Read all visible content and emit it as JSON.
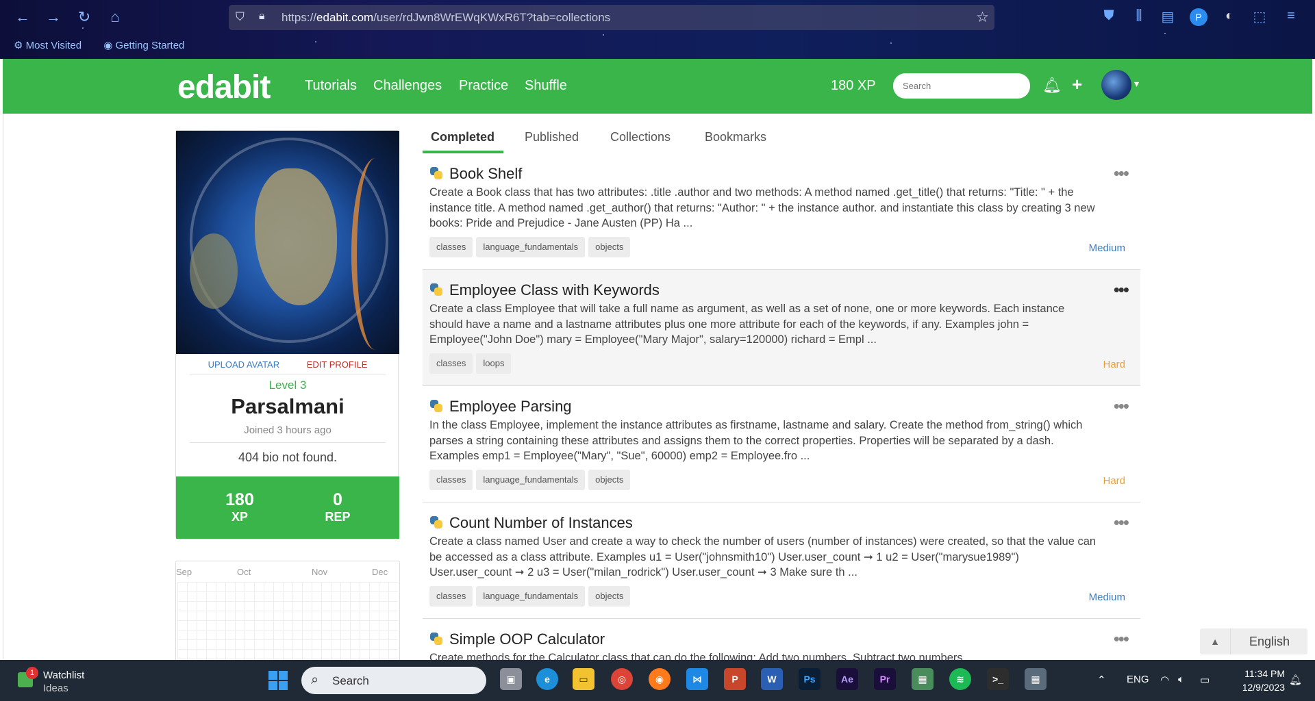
{
  "browser": {
    "url_prefix": "https://",
    "url_domain": "edabit.com",
    "url_path": "/user/rdJwn8WrEWqKWxR6T?tab=collections",
    "bookmarks": [
      "Most Visited",
      "Getting Started"
    ]
  },
  "site": {
    "logo": "edabit",
    "nav": [
      "Tutorials",
      "Challenges",
      "Practice",
      "Shuffle"
    ],
    "xp": "180 XP",
    "search_placeholder": "Search"
  },
  "profile": {
    "upload_avatar": "UPLOAD AVATAR",
    "edit_profile": "EDIT PROFILE",
    "level": "Level 3",
    "username": "Parsalmani",
    "joined": "Joined 3 hours ago",
    "bio": "404 bio not found.",
    "xp_value": "180",
    "xp_label": "XP",
    "rep_value": "0",
    "rep_label": "REP"
  },
  "calendar": {
    "months": [
      "Sep",
      "Oct",
      "Nov",
      "Dec"
    ]
  },
  "tabs": [
    "Completed",
    "Published",
    "Collections",
    "Bookmarks"
  ],
  "challenges": [
    {
      "title": "Book Shelf",
      "description": "Create a Book class that has two attributes: .title .author and two methods: A method named .get_title() that returns: \"Title: \" + the instance title. A method named .get_author() that returns: \"Author: \" + the instance author. and instantiate this class by creating 3 new books: Pride and Prejudice - Jane Austen (PP) Ha ...",
      "tags": [
        "classes",
        "language_fundamentals",
        "objects"
      ],
      "difficulty": "Medium"
    },
    {
      "title": "Employee Class with Keywords",
      "description": "Create a class Employee that will take a full name as argument, as well as a set of none, one or more keywords. Each instance should have a name and a lastname attributes plus one more attribute for each of the keywords, if any. Examples john = Employee(\"John Doe\") mary = Employee(\"Mary Major\", salary=120000) richard = Empl ...",
      "tags": [
        "classes",
        "loops"
      ],
      "difficulty": "Hard"
    },
    {
      "title": "Employee Parsing",
      "description": "In the class Employee, implement the instance attributes as firstname, lastname and salary. Create the method from_string() which parses a string containing these attributes and assigns them to the correct properties. Properties will be separated by a dash. Examples emp1 = Employee(\"Mary\", \"Sue\", 60000) emp2 = Employee.fro ...",
      "tags": [
        "classes",
        "language_fundamentals",
        "objects"
      ],
      "difficulty": "Hard"
    },
    {
      "title": "Count Number of Instances",
      "description": "Create a class named User and create a way to check the number of users (number of instances) were created, so that the value can be accessed as a class attribute. Examples u1 = User(\"johnsmith10\") User.user_count ➞ 1 u2 = User(\"marysue1989\") User.user_count ➞ 2 u3 = User(\"milan_rodrick\") User.user_count ➞ 3 Make sure th ...",
      "tags": [
        "classes",
        "language_fundamentals",
        "objects"
      ],
      "difficulty": "Medium"
    },
    {
      "title": "Simple OOP Calculator",
      "description": "Create methods for the Calculator class that can do the following: Add two numbers. Subtract two numbers.",
      "tags": [],
      "difficulty": ""
    }
  ],
  "language_widget": "English",
  "taskbar": {
    "watchlist_title": "Watchlist",
    "watchlist_sub": "Ideas",
    "watchlist_badge": "1",
    "search": "Search",
    "lang": "ENG",
    "time": "11:34 PM",
    "date": "12/9/2023"
  }
}
